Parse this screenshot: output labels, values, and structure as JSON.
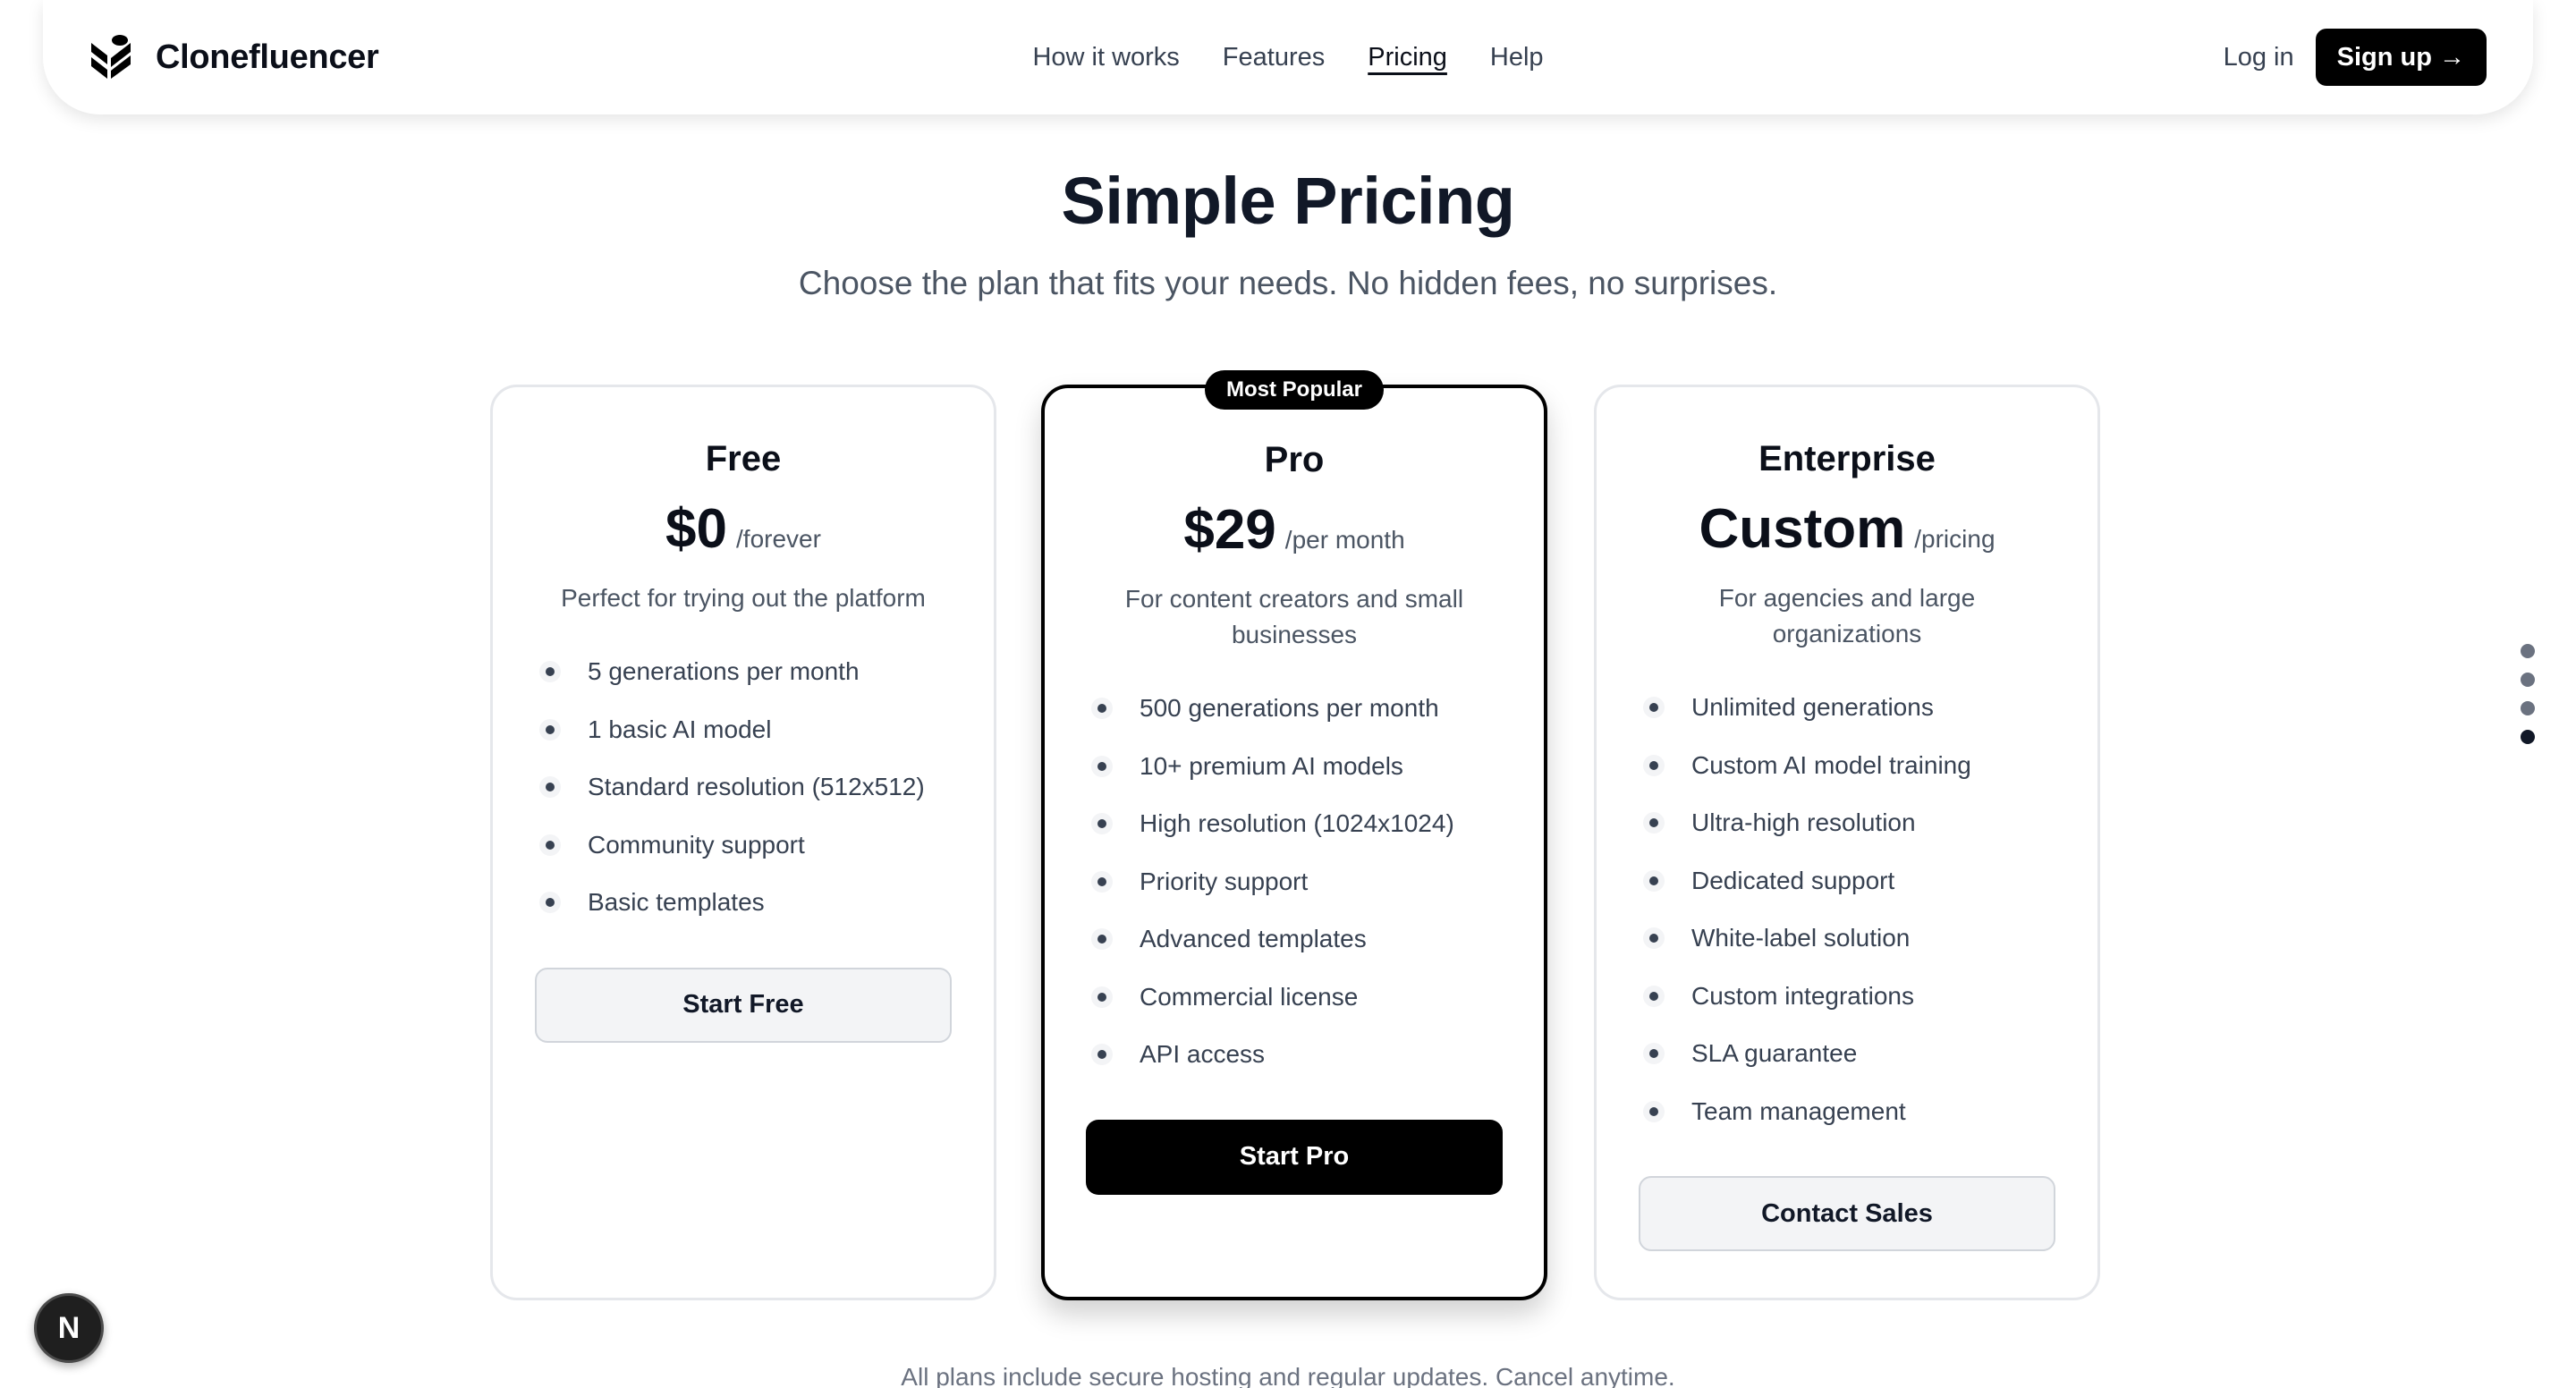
{
  "brand": {
    "name": "Clonefluencer",
    "icon": "clonefluencer-logo-icon"
  },
  "nav": {
    "links": [
      "How it works",
      "Features",
      "Pricing",
      "Help"
    ],
    "active": "Pricing",
    "login": "Log in",
    "signup": "Sign up →"
  },
  "hero": {
    "title": "Simple Pricing",
    "subtitle": "Choose the plan that fits your needs. No hidden fees, no surprises."
  },
  "plans": [
    {
      "name": "Free",
      "price": "$0",
      "period": "/forever",
      "description": "Perfect for trying out the platform",
      "features": [
        "5 generations per month",
        "1 basic AI model",
        "Standard resolution (512x512)",
        "Community support",
        "Basic templates"
      ],
      "cta": "Start Free"
    },
    {
      "name": "Pro",
      "badge": "Most Popular",
      "price": "$29",
      "period": "/per month",
      "description": "For content creators and small businesses",
      "features": [
        "500 generations per month",
        "10+ premium AI models",
        "High resolution (1024x1024)",
        "Priority support",
        "Advanced templates",
        "Commercial license",
        "API access"
      ],
      "cta": "Start Pro"
    },
    {
      "name": "Enterprise",
      "price": "Custom",
      "period": "/pricing",
      "description": "For agencies and large organizations",
      "features": [
        "Unlimited generations",
        "Custom AI model training",
        "Ultra-high resolution",
        "Dedicated support",
        "White-label solution",
        "Custom integrations",
        "SLA guarantee",
        "Team management"
      ],
      "cta": "Contact Sales"
    }
  ],
  "footnote": "All plans include secure hosting and regular updates. Cancel anytime.",
  "side_dots": {
    "count": 4,
    "active_index": 3
  },
  "dev_badge": {
    "letter": "N",
    "icon": "nextjs-badge-icon"
  },
  "colors": {
    "primary": "#000000",
    "text": "#111827",
    "muted": "#4b5563"
  }
}
